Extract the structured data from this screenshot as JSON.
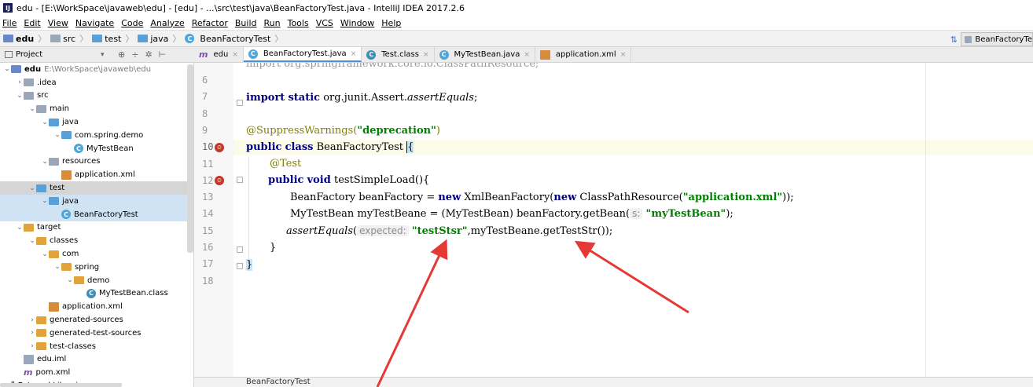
{
  "window": {
    "title": "edu - [E:\\WorkSpace\\javaweb\\edu] - [edu] - ...\\src\\test\\java\\BeanFactoryTest.java - IntelliJ IDEA 2017.2.6"
  },
  "menu": [
    "File",
    "Edit",
    "View",
    "Navigate",
    "Code",
    "Analyze",
    "Refactor",
    "Build",
    "Run",
    "Tools",
    "VCS",
    "Window",
    "Help"
  ],
  "breadcrumbs": [
    "edu",
    "src",
    "test",
    "java",
    "BeanFactoryTest"
  ],
  "run_config": "BeanFactoryTe",
  "project_panel": {
    "title": "Project"
  },
  "tree": [
    {
      "label": "edu",
      "note": "E:\\WorkSpace\\javaweb\\edu",
      "icon": "module-folder-icon",
      "depth": 0,
      "arrow": "open",
      "bold": true
    },
    {
      "label": ".idea",
      "icon": "folder-icon",
      "depth": 1,
      "arrow": "closed"
    },
    {
      "label": "src",
      "icon": "folder-icon",
      "depth": 1,
      "arrow": "open"
    },
    {
      "label": "main",
      "icon": "folder-icon",
      "depth": 2,
      "arrow": "open"
    },
    {
      "label": "java",
      "icon": "source-folder-icon",
      "depth": 3,
      "arrow": "open"
    },
    {
      "label": "com.spring.demo",
      "icon": "package-icon",
      "depth": 4,
      "arrow": "open"
    },
    {
      "label": "MyTestBean",
      "icon": "class-icon",
      "depth": 5,
      "arrow": "none"
    },
    {
      "label": "resources",
      "icon": "resources-folder-icon",
      "depth": 3,
      "arrow": "open"
    },
    {
      "label": "application.xml",
      "icon": "xml-file-icon",
      "depth": 4,
      "arrow": "none"
    },
    {
      "label": "test",
      "icon": "test-folder-icon",
      "depth": 2,
      "arrow": "open",
      "selected": "gray"
    },
    {
      "label": "java",
      "icon": "test-source-folder-icon",
      "depth": 3,
      "arrow": "open",
      "selected": "blue"
    },
    {
      "label": "BeanFactoryTest",
      "icon": "test-class-icon",
      "depth": 4,
      "arrow": "none",
      "selected": "blue"
    },
    {
      "label": "target",
      "icon": "excluded-folder-icon",
      "depth": 1,
      "arrow": "open"
    },
    {
      "label": "classes",
      "icon": "excluded-folder-icon",
      "depth": 2,
      "arrow": "open"
    },
    {
      "label": "com",
      "icon": "excluded-folder-icon",
      "depth": 3,
      "arrow": "open"
    },
    {
      "label": "spring",
      "icon": "excluded-folder-icon",
      "depth": 4,
      "arrow": "open"
    },
    {
      "label": "demo",
      "icon": "excluded-folder-icon",
      "depth": 5,
      "arrow": "open"
    },
    {
      "label": "MyTestBean.class",
      "icon": "compiled-class-icon",
      "depth": 6,
      "arrow": "none"
    },
    {
      "label": "application.xml",
      "icon": "xml-file-icon",
      "depth": 3,
      "arrow": "none"
    },
    {
      "label": "generated-sources",
      "icon": "excluded-folder-icon",
      "depth": 2,
      "arrow": "closed"
    },
    {
      "label": "generated-test-sources",
      "icon": "excluded-folder-icon",
      "depth": 2,
      "arrow": "closed"
    },
    {
      "label": "test-classes",
      "icon": "excluded-folder-icon",
      "depth": 2,
      "arrow": "closed"
    },
    {
      "label": "edu.iml",
      "icon": "iml-file-icon",
      "depth": 1,
      "arrow": "none"
    },
    {
      "label": "pom.xml",
      "icon": "maven-file-icon",
      "depth": 1,
      "arrow": "none"
    },
    {
      "label": "External Libraries",
      "icon": "libraries-icon",
      "depth": 0,
      "arrow": "closed"
    }
  ],
  "tabs": [
    {
      "label": "edu",
      "icon": "maven-file-icon",
      "active": false
    },
    {
      "label": "BeanFactoryTest.java",
      "icon": "class-icon",
      "active": true
    },
    {
      "label": "Test.class",
      "icon": "compiled-class-icon",
      "active": false
    },
    {
      "label": "MyTestBean.java",
      "icon": "class-icon",
      "active": false
    },
    {
      "label": "application.xml",
      "icon": "xml-file-icon",
      "active": false
    }
  ],
  "editor": {
    "line_numbers": [
      "6",
      "7",
      "8",
      "9",
      "10",
      "11",
      "12",
      "13",
      "14",
      "15",
      "16",
      "17",
      "18"
    ],
    "partial_top_line": "import org.springframework.core.io.ClassPathResource;",
    "code": {
      "l7_kw1": "import",
      "l7_kw2": "static",
      "l7_rest": " org.junit.Assert.",
      "l7_it": "assertEquals",
      "l7_end": ";",
      "l9_ann": "@SuppressWarnings(",
      "l9_str": "\"deprecation\"",
      "l9_end": ")",
      "l10_kw1": "public",
      "l10_kw2": "class",
      "l10_name": " BeanFactoryTest ",
      "l10_brace": "{",
      "l11_ann": "@Test",
      "l12_kw1": "public",
      "l12_kw2": "void",
      "l12_rest": " testSimpleLoad(){",
      "l13_a": "BeanFactory beanFactory = ",
      "l13_kw": "new",
      "l13_b": " XmlBeanFactory(",
      "l13_kw2": "new",
      "l13_c": " ClassPathResource(",
      "l13_str": "\"application.xml\"",
      "l13_end": "));",
      "l14_a": "MyTestBean myTestBeane = (MyTestBean) beanFactory.getBean(",
      "l14_hint": "s:",
      "l14_str": "\"myTestBean\"",
      "l14_end": ");",
      "l15_it": "assertEquals",
      "l15_a": "(",
      "l15_hint": "expected:",
      "l15_str": "\"testStsr\"",
      "l15_end": ",myTestBeane.getTestStr());",
      "l16": "}",
      "l17": "}"
    }
  },
  "status": {
    "breadcrumb": "BeanFactoryTest"
  },
  "annotation_color": "#e53935"
}
